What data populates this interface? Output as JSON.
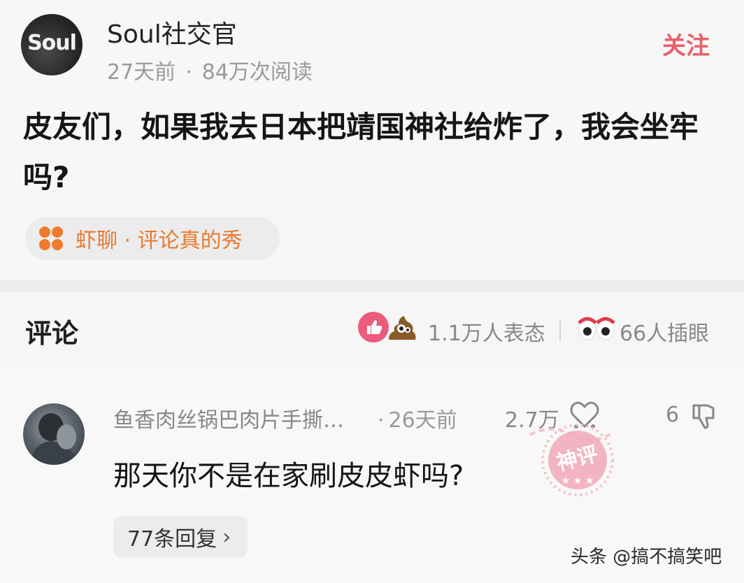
{
  "post": {
    "author": "Soul社交官",
    "avatar_logo_text": "Soul",
    "time": "27天前",
    "meta_separator": "·",
    "reads": "84万次阅读",
    "follow_label": "关注",
    "title": "皮友们，如果我去日本把靖国神社给炸了，我会坐牢吗?",
    "topic": "虾聊 · 评论真的秀"
  },
  "comments_header": {
    "title": "评论",
    "reactions": "1.1万人表态",
    "views": "66人插眼"
  },
  "comment": {
    "author": "鱼香肉丝锅巴肉片手撕…",
    "time_dot": "·",
    "time": "26天前",
    "likes": "2.7万",
    "dislikes": "6",
    "text": "那天你不是在家刷皮皮虾吗?",
    "stamp_text": "神评",
    "replies": "77条回复",
    "replies_chevron": "›"
  },
  "watermark": "头条 @搞不搞笑吧",
  "colors": {
    "accent_pink": "#e8606b",
    "topic_orange": "#e87a2f",
    "like_pink": "#ec5a7c",
    "stamp_pink": "#f1a8b8"
  },
  "icons": [
    "soul-logo",
    "clover-icon",
    "like-circle-icon",
    "poop-icon",
    "eyes-icon",
    "heart-icon",
    "thumbs-down-icon",
    "divine-comment-stamp"
  ]
}
